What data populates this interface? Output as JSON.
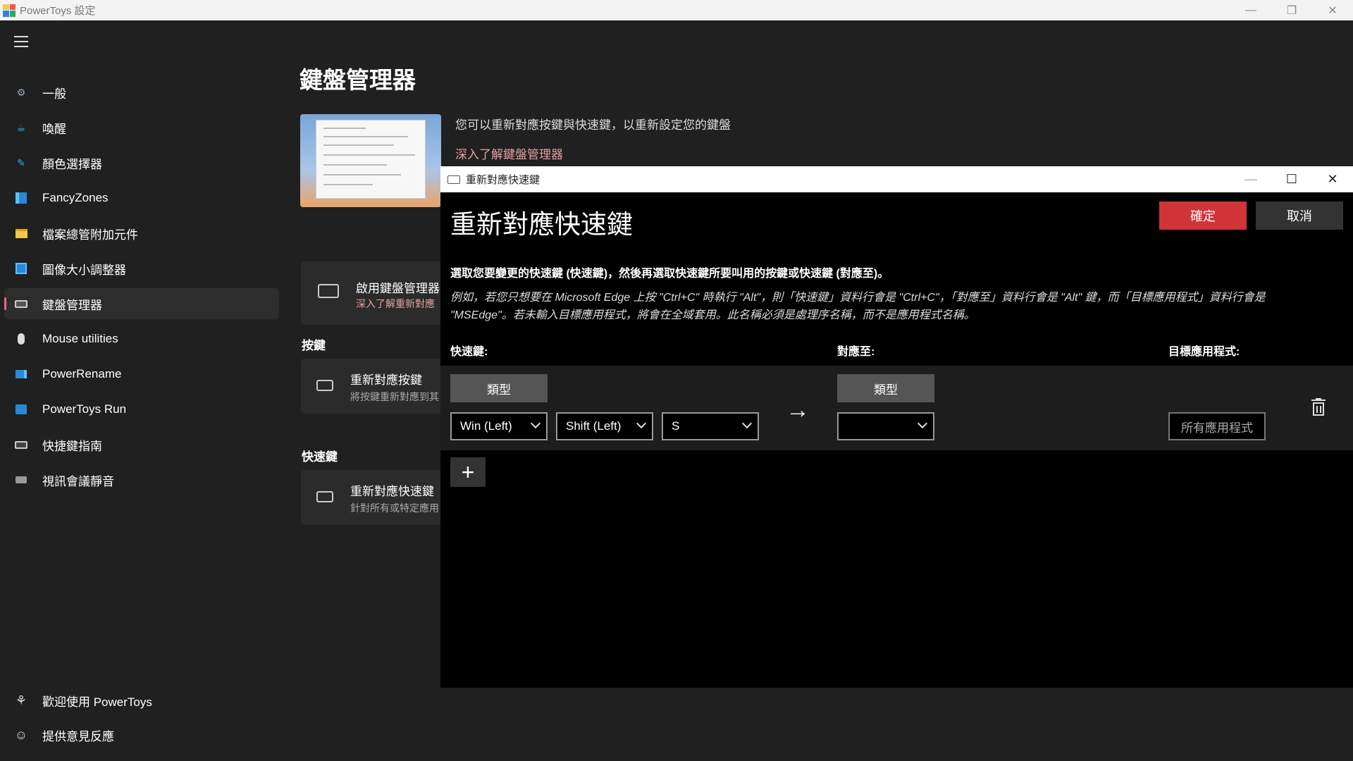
{
  "window": {
    "title": "PowerToys 設定"
  },
  "sidebar": {
    "items": [
      {
        "label": "一般",
        "icon": "gear-icon"
      },
      {
        "label": "喚醒",
        "icon": "coffee-cup-icon"
      },
      {
        "label": "顏色選擇器",
        "icon": "color-picker-icon"
      },
      {
        "label": "FancyZones",
        "icon": "fancyzones-icon"
      },
      {
        "label": "檔案總管附加元件",
        "icon": "folder-icon"
      },
      {
        "label": "圖像大小調整器",
        "icon": "image-resizer-icon"
      },
      {
        "label": "鍵盤管理器",
        "icon": "keyboard-icon"
      },
      {
        "label": "Mouse utilities",
        "icon": "mouse-icon"
      },
      {
        "label": "PowerRename",
        "icon": "rename-icon"
      },
      {
        "label": "PowerToys Run",
        "icon": "run-icon"
      },
      {
        "label": "快捷鍵指南",
        "icon": "shortcut-guide-icon"
      },
      {
        "label": "視訊會議靜音",
        "icon": "camera-icon"
      }
    ],
    "footer": [
      {
        "label": "歡迎使用 PowerToys",
        "icon": "welcome-icon"
      },
      {
        "label": "提供意見反應",
        "icon": "feedback-icon"
      }
    ]
  },
  "page": {
    "title": "鍵盤管理器",
    "description": "您可以重新對應按鍵與快速鍵，以重新設定您的鍵盤",
    "learn_more": "深入了解鍵盤管理器",
    "enable_card": {
      "title": "啟用鍵盤管理器",
      "subtitle": "深入了解重新對應"
    },
    "keys_section": "按鍵",
    "remap_keys_card": {
      "title": "重新對應按鍵",
      "subtitle": "將按鍵重新對應到其"
    },
    "shortcuts_section": "快速鍵",
    "remap_shortcuts_card": {
      "title": "重新對應快速鍵",
      "subtitle": "針對所有或特定應用"
    }
  },
  "dialog": {
    "window_title": "重新對應快速鍵",
    "heading": "重新對應快速鍵",
    "ok_label": "確定",
    "cancel_label": "取消",
    "instruction": "選取您要變更的快速鍵 (快速鍵)，然後再選取快速鍵所要叫用的按鍵或快速鍵 (對應至)。",
    "example_line1": "例如，若您只想要在 Microsoft Edge 上按 \"Ctrl+C\" 時執行 \"Alt\"，則「快速鍵」資料行會是 \"Ctrl+C\"，「對應至」資料行會是 \"Alt\" 鍵，而「目標應用程式」資料行會是",
    "example_line2": "\"MSEdge\"。若未輸入目標應用程式，將會在全域套用。此名稱必須是處理序名稱，而不是應用程式名稱。",
    "columns": {
      "shortcut": "快速鍵:",
      "map_to": "對應至:",
      "target_app": "目標應用程式:"
    },
    "row": {
      "type_label": "類型",
      "shortcut_keys": [
        "Win (Left)",
        "Shift (Left)",
        "S"
      ],
      "map_to_type_label": "類型",
      "map_to_value": "",
      "target_app_placeholder": "所有應用程式"
    },
    "add_label": "+"
  }
}
